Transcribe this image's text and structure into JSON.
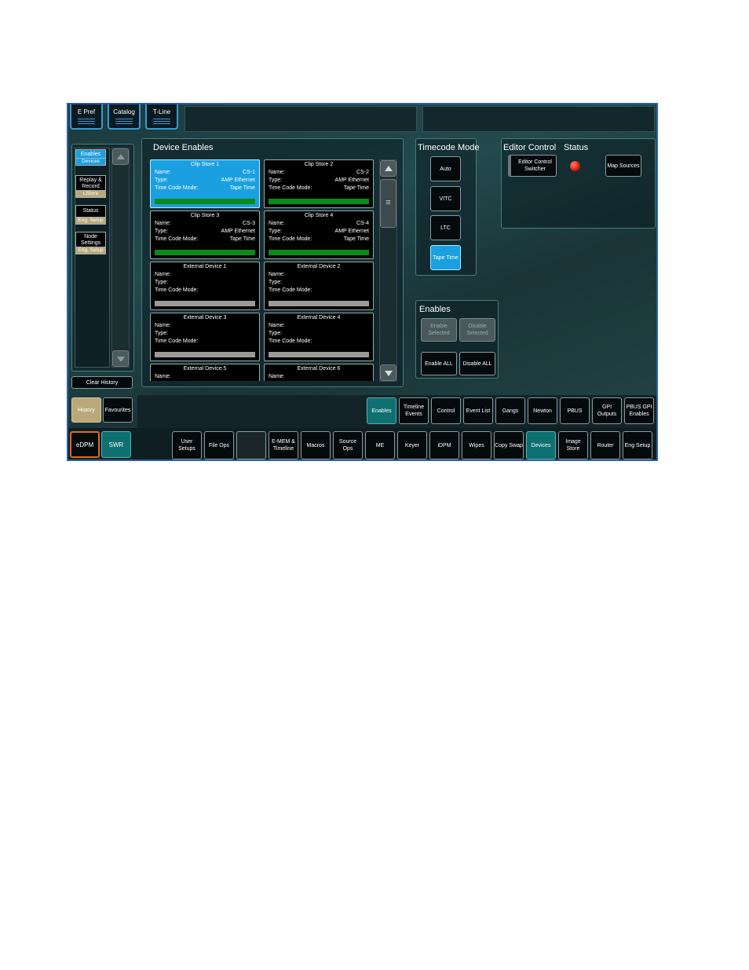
{
  "top_tabs": [
    "E Pref",
    "Catalog",
    "T-Line"
  ],
  "sidebar": {
    "items": [
      {
        "label": "Enables",
        "sub": "Devices"
      },
      {
        "label": "Replay & Record",
        "sub": "LStore"
      },
      {
        "label": "Status",
        "sub": "Eng. Setup"
      },
      {
        "label": "Node Settings",
        "sub": "Eng. Setup"
      }
    ],
    "clear_history": "Clear History",
    "history": "History",
    "favourites": "Favourites"
  },
  "device_enables": {
    "title": "Device Enables",
    "labels": {
      "name": "Name:",
      "type": "Type:",
      "tcm": "Time Code Mode:"
    },
    "cards": [
      {
        "title": "Clip Store 1",
        "name": "CS-1",
        "type": "AMP Ethernet",
        "tcm": "Tape Time",
        "status": "green",
        "selected": true
      },
      {
        "title": "Clip Store 2",
        "name": "CS-2",
        "type": "AMP Ethernet",
        "tcm": "Tape Time",
        "status": "green",
        "selected": false
      },
      {
        "title": "Clip Store 3",
        "name": "CS-3",
        "type": "AMP Ethernet",
        "tcm": "Tape Time",
        "status": "green",
        "selected": false
      },
      {
        "title": "Clip Store 4",
        "name": "CS-4",
        "type": "AMP Ethernet",
        "tcm": "Tape Time",
        "status": "green",
        "selected": false
      },
      {
        "title": "External Device 1",
        "name": "",
        "type": "",
        "tcm": "",
        "status": "gray",
        "selected": false
      },
      {
        "title": "External Device 2",
        "name": "",
        "type": "",
        "tcm": "",
        "status": "gray",
        "selected": false
      },
      {
        "title": "External Device 3",
        "name": "",
        "type": "",
        "tcm": "",
        "status": "gray",
        "selected": false
      },
      {
        "title": "External Device 4",
        "name": "",
        "type": "",
        "tcm": "",
        "status": "gray",
        "selected": false
      },
      {
        "title": "External Device 5",
        "name": "",
        "type": "",
        "tcm": "",
        "status": "gray",
        "selected": false
      },
      {
        "title": "External Device 6",
        "name": "",
        "type": "",
        "tcm": "",
        "status": "gray",
        "selected": false
      }
    ]
  },
  "timecode_mode": {
    "title": "Timecode Mode",
    "buttons": [
      "Auto",
      "VITC",
      "LTC",
      "Tape Time"
    ],
    "active": "Tape Time"
  },
  "editor_control": {
    "title": "Editor Control",
    "status_title": "Status",
    "button": "Editor Control Switcher",
    "status_color": "#e02010",
    "map_sources": "Map Sources"
  },
  "enables": {
    "title": "Enables",
    "enable_selected": "Enable Selected",
    "disable_selected": "Disable Selected",
    "enable_all": "Enable ALL",
    "disable_all": "Disable ALL"
  },
  "bottom_row1": [
    "Enables",
    "Timeline Events",
    "Control",
    "Event List",
    "Gangs",
    "Newton",
    "PBUS",
    "GPI Outputs",
    "PBUS GPI Enables"
  ],
  "bottom_row1_active": "Enables",
  "mode_buttons": {
    "edpm": "eDPM",
    "swr": "SWR"
  },
  "bottom_row2": [
    "User Setups",
    "File Ops",
    "",
    "E-MEM & Timeline",
    "Macros",
    "Source Ops",
    "ME",
    "Keyer",
    "iDPM",
    "Wipes",
    "Copy Swap",
    "Devices",
    "Image Store",
    "Router",
    "Eng Setup"
  ],
  "bottom_row2_active": "Devices"
}
